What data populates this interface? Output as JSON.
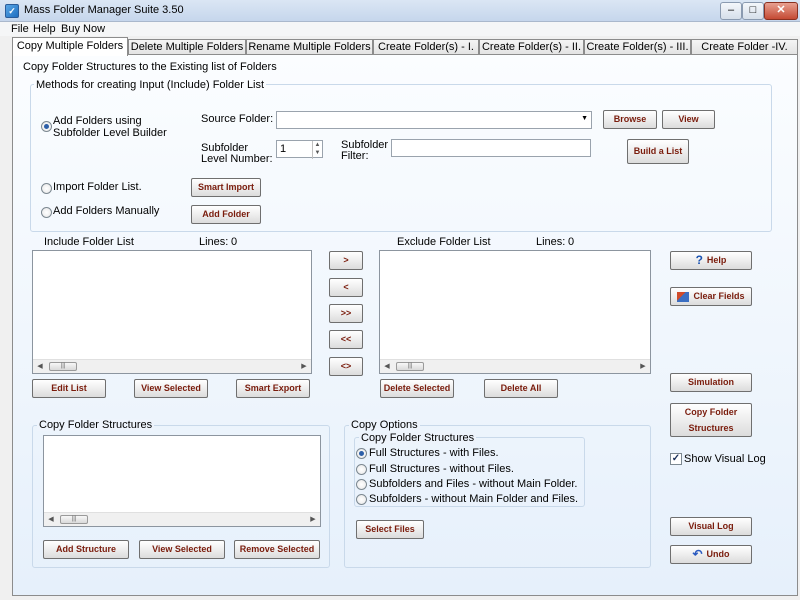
{
  "window": {
    "title": "Mass Folder Manager Suite 3.50",
    "icon_letter": "✓",
    "minimize": "–",
    "maximize": "□",
    "close": "✕"
  },
  "menu": [
    "File",
    "Help",
    "Buy Now"
  ],
  "tabs": [
    {
      "label": "Copy Multiple Folders",
      "active": true
    },
    {
      "label": "Delete Multiple Folders"
    },
    {
      "label": "Rename Multiple Folders"
    },
    {
      "label": "Create Folder(s)   - I."
    },
    {
      "label": "Create Folder(s)  - II."
    },
    {
      "label": "Create Folder(s)  - III."
    },
    {
      "label": "Create Folder -IV."
    }
  ],
  "page": {
    "heading": "Copy Folder Structures to the Existing list of Folders",
    "methods_title": "Methods for creating Input (Include) Folder List",
    "method_subfolder": "Add Folders using Subfolder Level Builder",
    "method_import": "Import Folder List.",
    "method_manual": "Add Folders Manually",
    "source_folder_label": "Source Folder:",
    "source_folder_value": "",
    "browse": "Browse",
    "view": "View",
    "subfolder_level_label": "Subfolder Level Number:",
    "subfolder_level_value": "1",
    "subfolder_filter_label": "Subfolder Filter:",
    "subfolder_filter_value": "",
    "build_list": "Build a List",
    "smart_import": "Smart Import",
    "add_folder": "Add Folder"
  },
  "include": {
    "title": "Include Folder List",
    "lines_label": "Lines:",
    "lines_value": "0",
    "edit_list": "Edit List",
    "view_selected": "View Selected",
    "smart_export": "Smart Export"
  },
  "transfer": [
    ">",
    "<",
    ">>",
    "<<",
    "<>"
  ],
  "exclude": {
    "title": "Exclude Folder List",
    "lines_label": "Lines:",
    "lines_value": "0",
    "delete_selected": "Delete Selected",
    "delete_all": "Delete All"
  },
  "right": {
    "help": "Help",
    "clear_fields": "Clear Fields",
    "simulation": "Simulation",
    "copy_structures_1": "Copy Folder",
    "copy_structures_2": "Structures",
    "show_visual_log": "Show Visual Log",
    "visual_log": "Visual Log",
    "undo": "Undo"
  },
  "copy_structures": {
    "title": "Copy Folder Structures",
    "add_structure": "Add Structure",
    "view_selected": "View Selected",
    "remove_selected": "Remove Selected"
  },
  "copy_options": {
    "title": "Copy Options",
    "subtitle": "Copy Folder Structures",
    "options": [
      "Full Structures - with Files.",
      "Full Structures - without Files.",
      "Subfolders and Files - without Main Folder.",
      "Subfolders - without Main Folder and Files."
    ],
    "selected_index": 0,
    "select_files": "Select Files"
  }
}
